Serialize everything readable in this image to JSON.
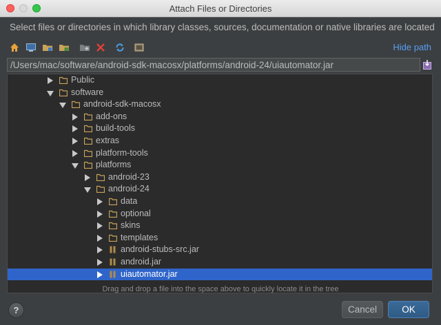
{
  "window": {
    "title": "Attach Files or Directories"
  },
  "description": "Select files or directories in which library classes, sources, documentation or native libraries are located",
  "toolbar": {
    "buttons": [
      {
        "icon": "home-icon"
      },
      {
        "icon": "desktop-icon"
      },
      {
        "icon": "project-folder-icon"
      },
      {
        "icon": "module-folder-icon"
      },
      {
        "icon": "new-folder-icon"
      },
      {
        "icon": "delete-icon"
      },
      {
        "icon": "refresh-icon"
      },
      {
        "icon": "show-hidden-icon"
      }
    ],
    "hide_path_label": "Hide path"
  },
  "path_field": {
    "value": "/Users/mac/software/android-sdk-macosx/platforms/android-24/uiautomator.jar"
  },
  "tree": {
    "items": [
      {
        "label": "Public",
        "depth": 0,
        "state": "collapsed",
        "kind": "folder"
      },
      {
        "label": "software",
        "depth": 0,
        "state": "expanded",
        "kind": "folder"
      },
      {
        "label": "android-sdk-macosx",
        "depth": 1,
        "state": "expanded",
        "kind": "folder"
      },
      {
        "label": "add-ons",
        "depth": 2,
        "state": "collapsed",
        "kind": "folder"
      },
      {
        "label": "build-tools",
        "depth": 2,
        "state": "collapsed",
        "kind": "folder"
      },
      {
        "label": "extras",
        "depth": 2,
        "state": "collapsed",
        "kind": "folder"
      },
      {
        "label": "platform-tools",
        "depth": 2,
        "state": "collapsed",
        "kind": "folder"
      },
      {
        "label": "platforms",
        "depth": 2,
        "state": "expanded",
        "kind": "folder"
      },
      {
        "label": "android-23",
        "depth": 3,
        "state": "collapsed",
        "kind": "folder"
      },
      {
        "label": "android-24",
        "depth": 3,
        "state": "expanded",
        "kind": "folder"
      },
      {
        "label": "data",
        "depth": 4,
        "state": "collapsed",
        "kind": "folder"
      },
      {
        "label": "optional",
        "depth": 4,
        "state": "collapsed",
        "kind": "folder"
      },
      {
        "label": "skins",
        "depth": 4,
        "state": "collapsed",
        "kind": "folder"
      },
      {
        "label": "templates",
        "depth": 4,
        "state": "collapsed",
        "kind": "folder"
      },
      {
        "label": "android-stubs-src.jar",
        "depth": 4,
        "state": "collapsed",
        "kind": "jar"
      },
      {
        "label": "android.jar",
        "depth": 4,
        "state": "collapsed",
        "kind": "jar"
      },
      {
        "label": "uiautomator.jar",
        "depth": 4,
        "state": "collapsed",
        "kind": "jar",
        "selected": true
      }
    ]
  },
  "hint": "Drag and drop a file into the space above to quickly locate it in the tree",
  "buttons": {
    "help": "?",
    "cancel": "Cancel",
    "ok": "OK"
  },
  "colors": {
    "accent": "#589df6",
    "selection": "#2f65ca",
    "folder": "#c9a35a"
  }
}
